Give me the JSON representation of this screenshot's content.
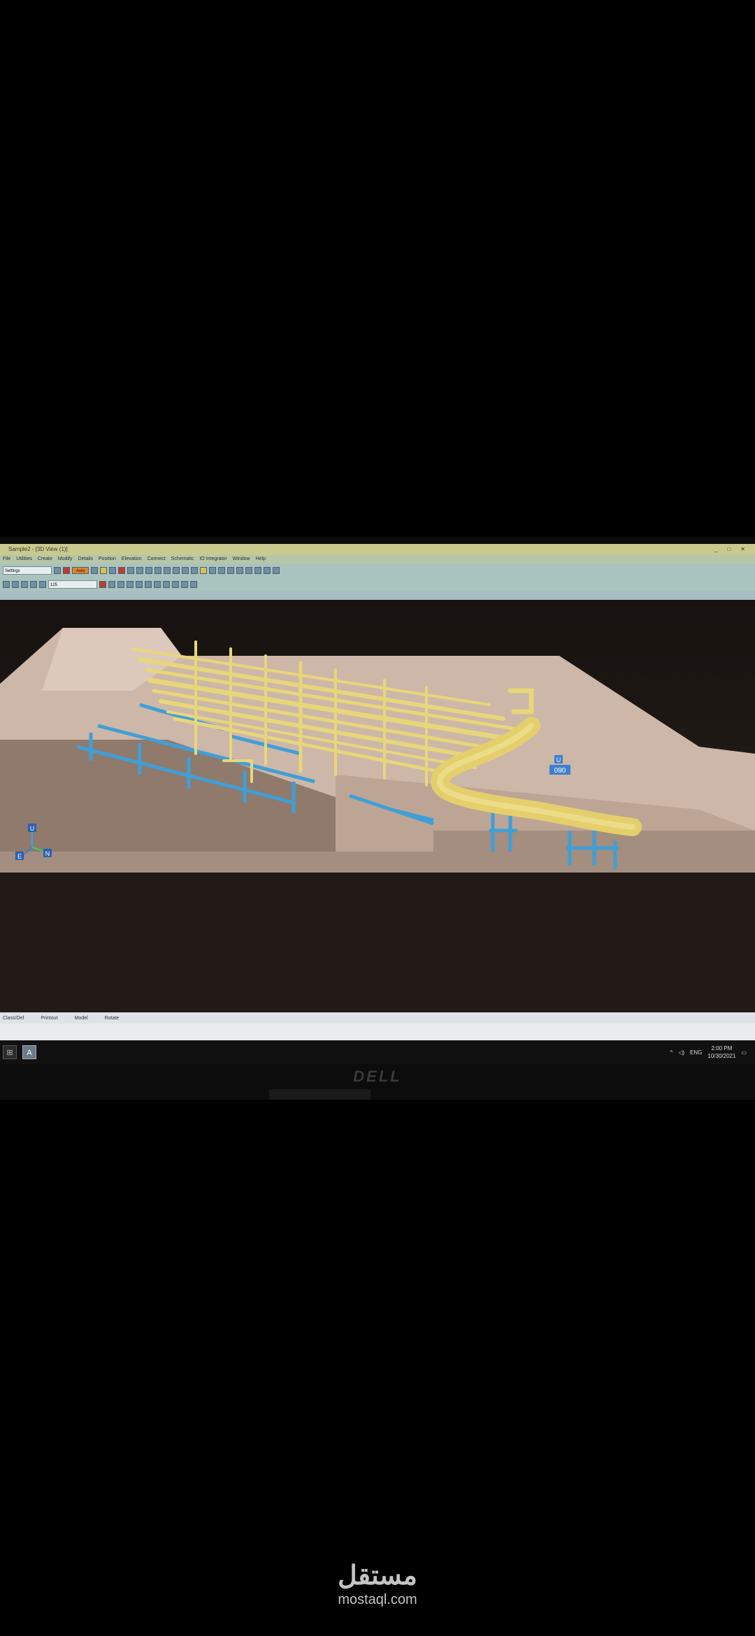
{
  "window": {
    "title": "Sample2 - [3D View (1)]",
    "controls": [
      "_",
      "□",
      "✕"
    ]
  },
  "menu": {
    "items": [
      "File",
      "Utilities",
      "Create",
      "Modify",
      "Details",
      "Position",
      "Elevation",
      "Connect",
      "Schematic",
      "IO Integrator",
      "Window",
      "Help"
    ]
  },
  "toolbar": {
    "view_select": "Settings",
    "auto_label": "Auto",
    "select_value": "125"
  },
  "tabs": {
    "items": [
      "Class/Def",
      "Printout",
      "Model",
      "Rotate"
    ]
  },
  "viewport": {
    "nav_cube_label": "090",
    "nav_cube_top": "U",
    "axis_up": "U",
    "axis_east": "E",
    "axis_north": "N",
    "colors": {
      "concrete": "#cdb7a8",
      "pipe": "#e8d67a",
      "steel": "#3f9fd8"
    }
  },
  "taskbar": {
    "app_icon": "A",
    "language": "ENG",
    "time": "2:00 PM",
    "date": "10/30/2021"
  },
  "monitor": {
    "brand": "DELL"
  },
  "watermark": {
    "arabic": "مستقل",
    "latin": "mostaql.com"
  }
}
